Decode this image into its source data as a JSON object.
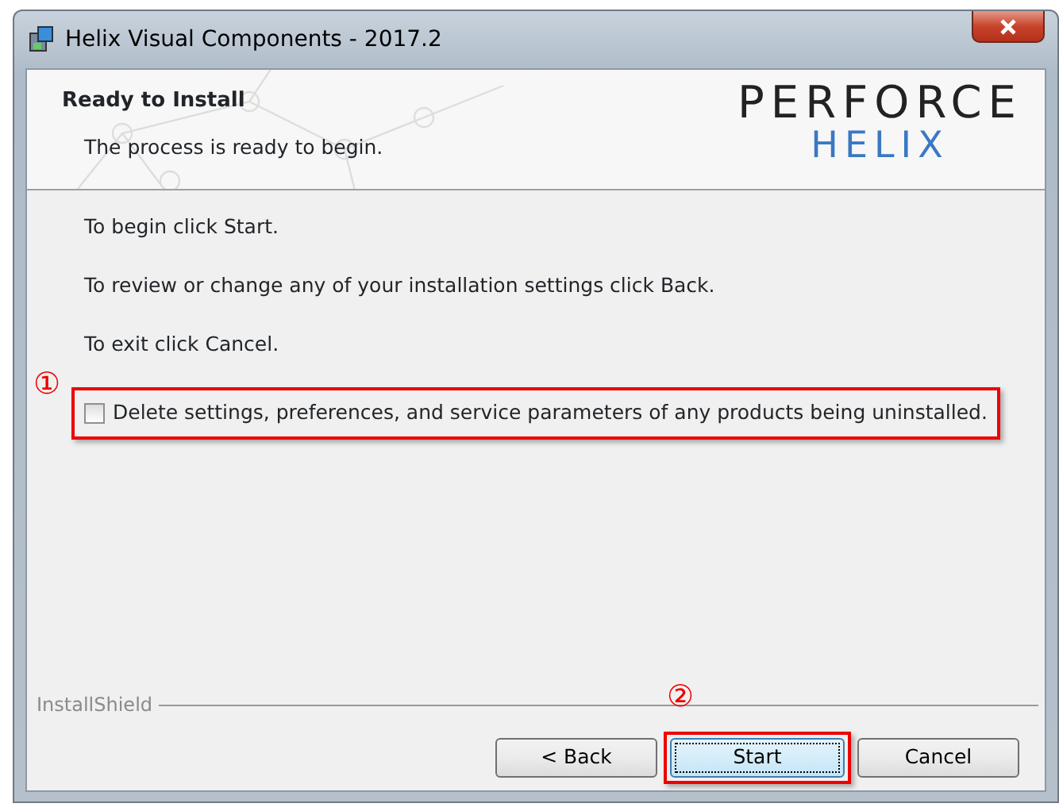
{
  "window": {
    "title": "Helix Visual Components - 2017.2"
  },
  "header": {
    "title": "Ready to Install",
    "subtitle": "The process is ready to begin.",
    "logo_top": "PERFORCE",
    "logo_bottom": "HELIX"
  },
  "instructions": [
    "To begin click Start.",
    "To review or change any of your installation settings click Back.",
    "To exit click Cancel."
  ],
  "checkbox": {
    "label": "Delete settings, preferences, and service parameters of any products being uninstalled.",
    "checked": false,
    "annotation": "①"
  },
  "footer": {
    "brand": "InstallShield"
  },
  "buttons": [
    {
      "label": "< Back",
      "default": false
    },
    {
      "label": "Start",
      "default": true,
      "annotation": "②"
    },
    {
      "label": "Cancel",
      "default": false
    }
  ]
}
